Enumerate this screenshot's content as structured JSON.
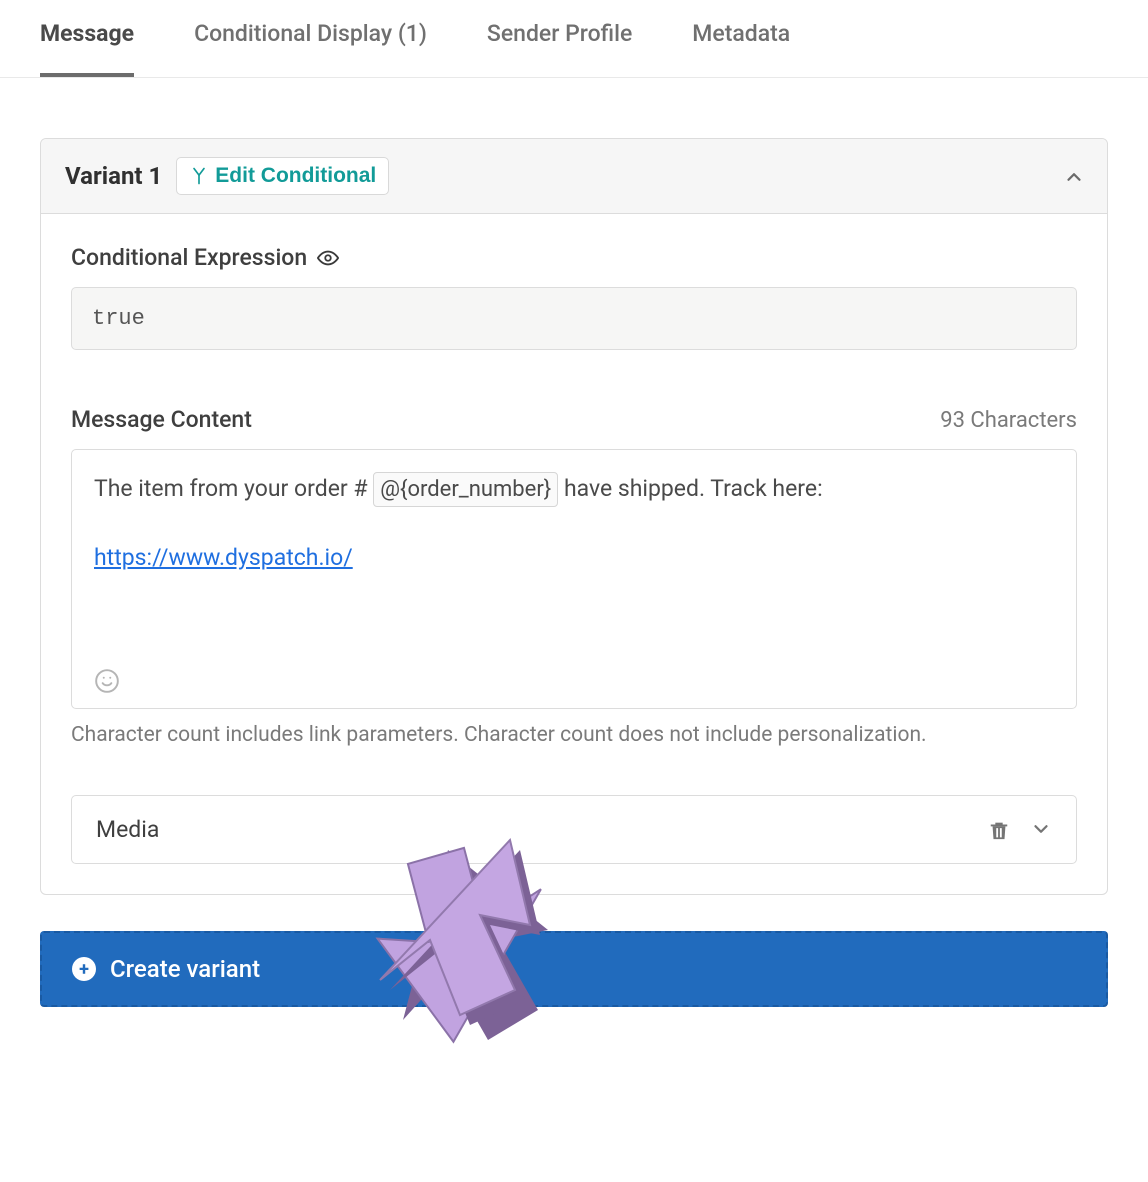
{
  "tabs": {
    "message": "Message",
    "conditional_display": "Conditional Display (1)",
    "sender_profile": "Sender Profile",
    "metadata": "Metadata"
  },
  "variant": {
    "title": "Variant 1",
    "edit_conditional_label": "Edit Conditional",
    "expression_label": "Conditional Expression",
    "expression_value": "true",
    "message_content_label": "Message Content",
    "char_count": "93 Characters",
    "content_prefix": "The item from your order # ",
    "content_token": "@{order_number}",
    "content_suffix": " have shipped. Track here:",
    "content_link": "https://www.dyspatch.io/",
    "hint": "Character count includes link parameters. Character count does not include personalization.",
    "media_label": "Media"
  },
  "create_variant_label": "Create variant",
  "icons": {
    "branch": "branch-icon",
    "eye": "eye-icon",
    "emoji": "emoji-icon",
    "trash": "trash-icon",
    "chevron_down": "chevron-down-icon",
    "chevron_up": "chevron-up-icon",
    "plus": "plus-icon"
  }
}
